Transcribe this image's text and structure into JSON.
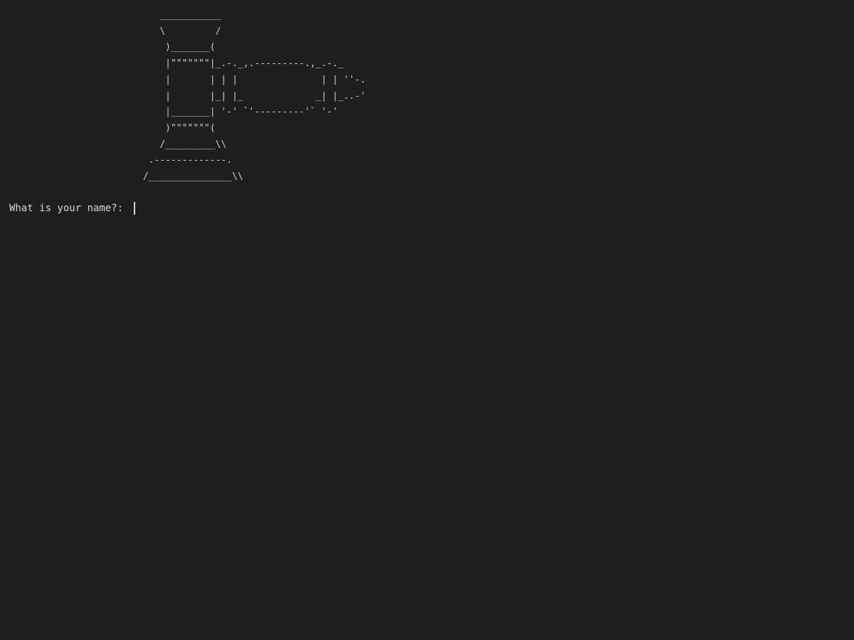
{
  "terminal": {
    "ascii_art_lines": [
      "                           ___________",
      "                           \\         /",
      "                            )_______(",
      "                            |\"\"\"\"\"\"\"|_.-._,.---------.,_.-._",
      "                            |       | | |               | | ''-.",
      "                            |       |_| |_             _| |_..-'",
      "                            |_______| '-' `'---------'` '-'",
      "                            )\"\"\"\"\"\"\"(",
      "                           /_________\\\\",
      "                         .-------------.",
      "                        /_______________\\\\"
    ],
    "prompt_text": "What is your name?: ",
    "input_value": ""
  }
}
